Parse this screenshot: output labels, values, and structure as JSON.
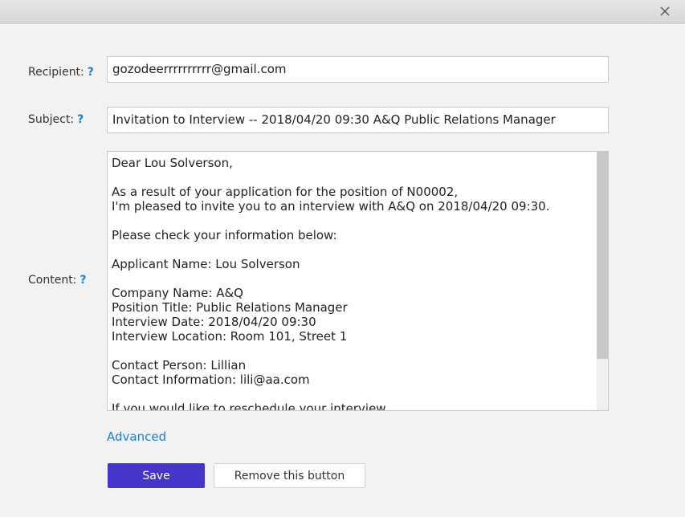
{
  "dialog": {
    "close_icon": "close-icon"
  },
  "form": {
    "recipient_label": "Recipient:",
    "recipient_help": "?",
    "recipient_value": "gozodeerrrrrrrrrr@gmail.com",
    "subject_label": "Subject:",
    "subject_help": "?",
    "subject_value": "Invitation to Interview -- 2018/04/20 09:30 A&Q Public Relations Manager",
    "content_label": "Content:",
    "content_help": "?",
    "content_lines": [
      "Dear Lou Solverson,",
      "",
      "As a result of your application for the position of N00002,",
      "I'm pleased to invite you to an interview with A&Q on 2018/04/20 09:30.",
      "",
      "Please check your information below:",
      "",
      "Applicant Name: Lou Solverson",
      "",
      "Company Name: A&Q",
      "Position Title: Public Relations Manager",
      "Interview Date: 2018/04/20 09:30",
      "Interview Location: Room 101, Street 1",
      "",
      "Contact Person: Lillian",
      "Contact Information: lili@aa.com",
      "",
      "If you would like to reschedule your interview"
    ],
    "advanced_link": "Advanced"
  },
  "actions": {
    "save_label": "Save",
    "remove_label": "Remove this button"
  },
  "colors": {
    "accent": "#4535c8",
    "link": "#1a7fd0"
  }
}
